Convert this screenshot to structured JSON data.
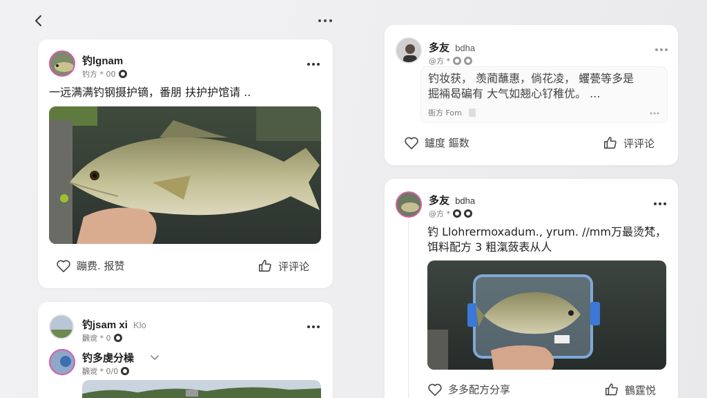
{
  "nav": {
    "back_icon": "chevron-left-icon",
    "more_icon": "more-horizontal-icon"
  },
  "posts": [
    {
      "username": "钓lgnam",
      "meta": "钓方 * 00",
      "text": "一远满满钓钢摄护镝，番朋 扶护护馆请 ..",
      "like_label": "蹦费. 报赞",
      "comment_label": "评评论"
    },
    {
      "username": "钓jsam xi",
      "username_suffix": "Klo",
      "meta": "飜谠 * 0",
      "sub_username": "钓多虔分橾",
      "sub_meta": "飜谠 * 0/0"
    },
    {
      "username": "多友",
      "username_suffix": "bdha",
      "meta": "@方 *",
      "quote_line1": "钓妆获，  羡蔺蘸惠，倘花凌，  蠼甍等多是",
      "quote_line2": "掘裲曷碥有 大气如翘心钌稚优。 ...",
      "quote_meta": "衙方 Fom",
      "like_label": "鑪度  鏂数",
      "comment_label": "评评论"
    },
    {
      "username": "多友",
      "username_suffix": "bdha",
      "meta": "@方 *",
      "text_line1": "钓 Llohrermoxadum.,  yrum. //mm万最烫梵，",
      "text_line2": "饵料配方 3   粗滊蔹表从人",
      "like_label": "多多配方分享",
      "comment_label": "鶴霆悦"
    }
  ],
  "colors": {
    "avatar_ring": "#d85ca8",
    "card_bg": "#ffffff",
    "page_bg": "#efeff1"
  }
}
